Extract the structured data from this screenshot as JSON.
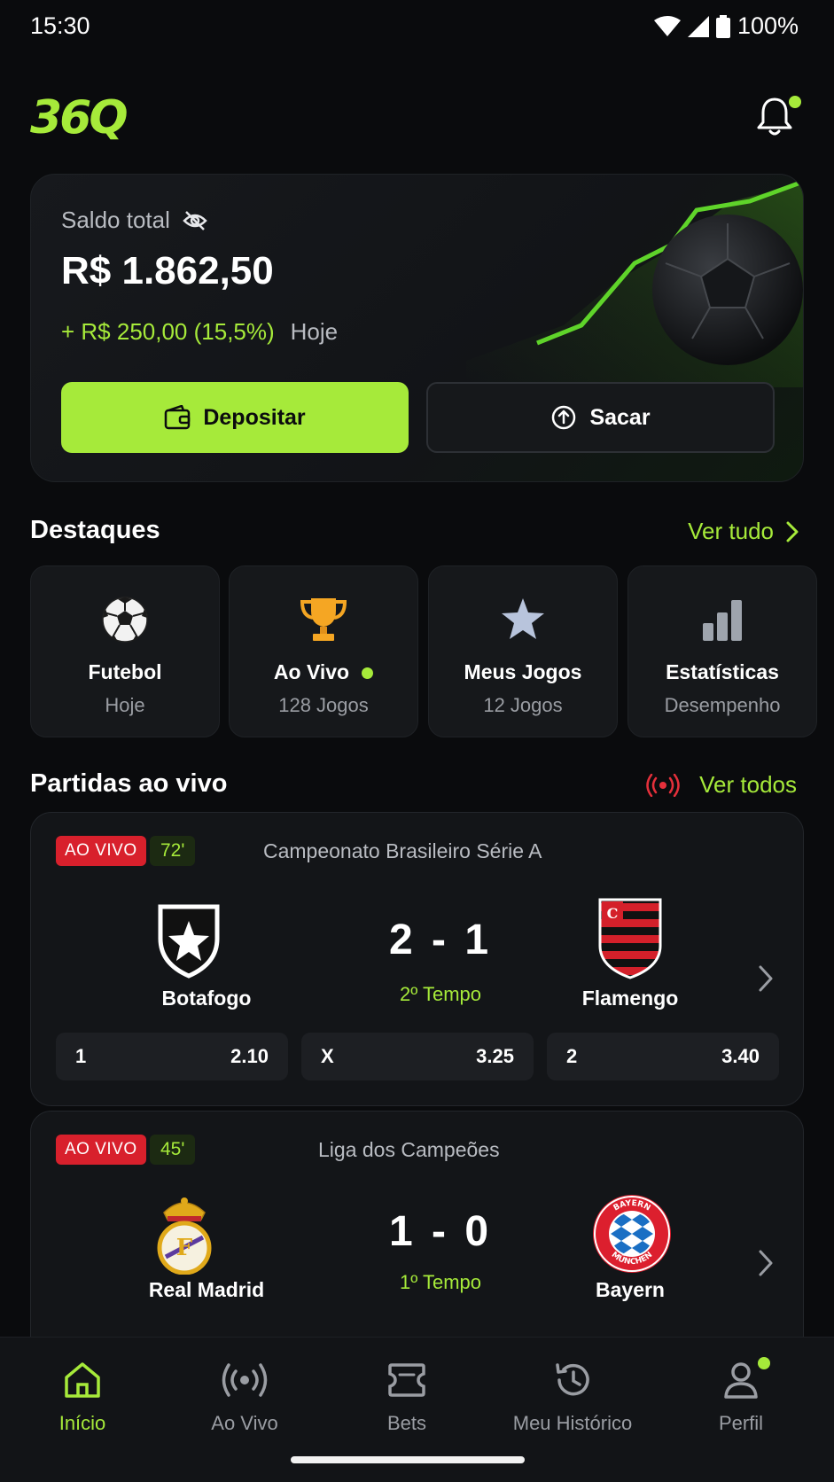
{
  "status_bar": {
    "time": "15:30",
    "battery": "100%"
  },
  "header": {
    "logo": "36Q"
  },
  "balance": {
    "label": "Saldo total",
    "amount": "R$ 1.862,50",
    "change": "+ R$ 250,00 (15,5%)",
    "period": "Hoje",
    "deposit_label": "Depositar",
    "withdraw_label": "Sacar"
  },
  "highlights": {
    "title": "Destaques",
    "see_all": "Ver tudo",
    "items": [
      {
        "title": "Futebol",
        "subtitle": "Hoje",
        "icon": "soccer-ball-icon"
      },
      {
        "title": "Ao Vivo",
        "subtitle": "128 Jogos",
        "icon": "trophy-icon"
      },
      {
        "title": "Meus Jogos",
        "subtitle": "12 Jogos",
        "icon": "star-icon"
      },
      {
        "title": "Estatísticas",
        "subtitle": "Desempenho",
        "icon": "bar-chart-icon"
      }
    ]
  },
  "live_matches": {
    "title": "Partidas ao vivo",
    "see_all": "Ver todos",
    "matches": [
      {
        "badge": "AO VIVO",
        "minute": "72'",
        "league": "Campeonato Brasileiro Série A",
        "home": "Botafogo",
        "away": "Flamengo",
        "score": "2 - 1",
        "period": "2º Tempo",
        "odds": [
          {
            "label": "1",
            "value": "2.10"
          },
          {
            "label": "X",
            "value": "3.25"
          },
          {
            "label": "2",
            "value": "3.40"
          }
        ]
      },
      {
        "badge": "AO VIVO",
        "minute": "45'",
        "league": "Liga dos Campeões",
        "home": "Real Madrid",
        "away": "Bayern",
        "score": "1 - 0",
        "period": "1º Tempo",
        "crest_text": "BAYERN MÜNCHEN"
      }
    ]
  },
  "bottom_nav": [
    {
      "label": "Início",
      "icon": "home-icon",
      "active": true
    },
    {
      "label": "Ao Vivo",
      "icon": "broadcast-icon"
    },
    {
      "label": "Bets",
      "icon": "ticket-icon"
    },
    {
      "label": "Meu Histórico",
      "icon": "history-icon"
    },
    {
      "label": "Perfil",
      "icon": "user-icon"
    }
  ],
  "colors": {
    "accent": "#a6ea3a",
    "live": "#d8202c",
    "background": "#0a0b0d"
  }
}
